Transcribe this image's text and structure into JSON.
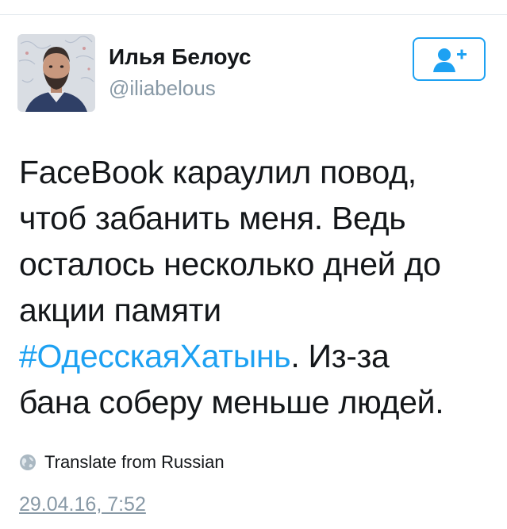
{
  "tweet": {
    "author_name": "Илья Белоус",
    "author_handle": "@iliabelous",
    "follow_icon": "add-user-icon",
    "text_lines": [
      "FaceBook караулил повод,",
      "чтоб забанить меня. Ведь",
      "осталось несколько дней до",
      "акции памяти"
    ],
    "hashtag": "#ОдесскаяХатынь",
    "text_after_hashtag": ". Из-за",
    "text_last_line": "бана соберу меньше людей.",
    "translate_label": "Translate from Russian",
    "translate_icon": "globe-icon",
    "timestamp": "29.04.16, 7:52"
  },
  "colors": {
    "accent": "#1da1f2",
    "text": "#14171a",
    "muted": "#8899a6"
  }
}
